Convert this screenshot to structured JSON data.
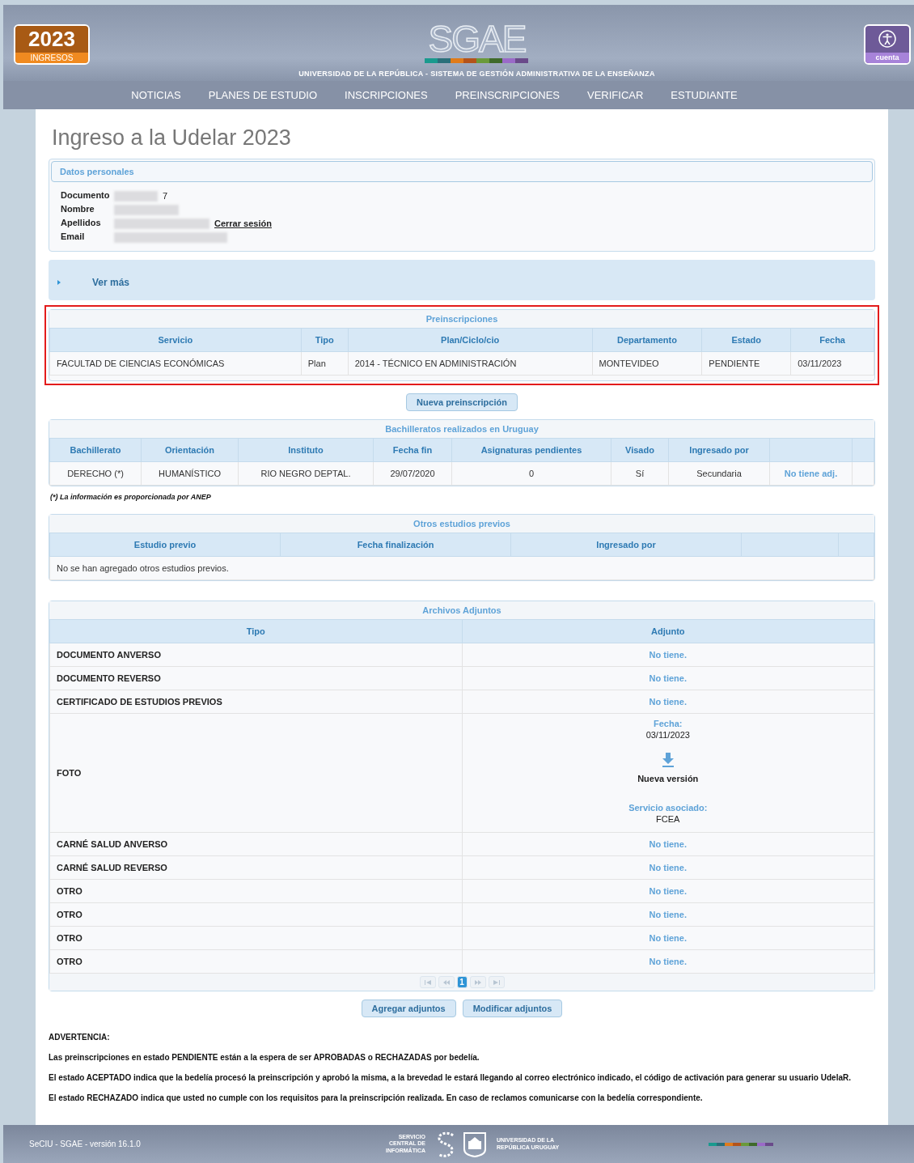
{
  "header": {
    "badge": {
      "year": "2023",
      "label": "INGRESOS"
    },
    "logo": {
      "text": "SGAE",
      "tagline": "UNIVERSIDAD DE LA REPÚBLICA - SISTEMA DE GESTIÓN ADMINISTRATIVA DE LA ENSEÑANZA"
    },
    "account": {
      "label": "cuenta"
    },
    "nav": [
      {
        "label": "NOTICIAS"
      },
      {
        "label": "PLANES DE ESTUDIO"
      },
      {
        "label": "INSCRIPCIONES"
      },
      {
        "label": "PREINSCRIPCIONES"
      },
      {
        "label": "VERIFICAR"
      },
      {
        "label": "ESTUDIANTE"
      }
    ]
  },
  "page_title": "Ingreso a la Udelar 2023",
  "personal": {
    "title": "Datos personales",
    "fields": [
      {
        "label": "Documento",
        "value": "7",
        "redacted": true
      },
      {
        "label": "Nombre",
        "redacted": true
      },
      {
        "label": "Apellidos",
        "redacted": true
      },
      {
        "label": "Email",
        "redacted": true
      }
    ],
    "logout": "Cerrar sesión"
  },
  "ver_mas": {
    "label": "Ver más",
    "expanded": false
  },
  "preinscripciones": {
    "title": "Preinscripciones",
    "highlighted": true,
    "columns": [
      "Servicio",
      "Tipo",
      "Plan/Ciclo/cio",
      "Departamento",
      "Estado",
      "Fecha"
    ],
    "rows": [
      [
        "FACULTAD DE CIENCIAS ECONÓMICAS",
        "Plan",
        "2014 - TÉCNICO EN ADMINISTRACIÓN",
        "MONTEVIDEO",
        "PENDIENTE",
        "03/11/2023"
      ]
    ]
  },
  "new_button": "Nueva preinscripción",
  "bachilleratos": {
    "title": "Bachilleratos realizados en Uruguay",
    "columns": [
      "Bachillerato",
      "Orientación",
      "Instituto",
      "Fecha fin",
      "Asignaturas pendientes",
      "Visado",
      "Ingresado por"
    ],
    "rows": [
      {
        "cells": [
          "DERECHO (*)",
          "HUMANÍSTICO",
          "RIO NEGRO DEPTAL.",
          "29/07/2020",
          "0",
          "Sí",
          "Secundaria"
        ],
        "link": "No tiene adj."
      }
    ]
  },
  "note": "(*) La información es proporcionada por ANEP",
  "otros": {
    "title": "Otros estudios previos",
    "columns": [
      "Estudio previo",
      "Fecha finalización",
      "Ingresado por"
    ],
    "empty_message": "No se han agregado otros estudios previos."
  },
  "archivos": {
    "title": "Archivos Adjuntos",
    "columns": [
      "Tipo",
      "Adjunto"
    ],
    "rows": [
      {
        "tipo": "DOCUMENTO ANVERSO",
        "kind": "none",
        "adjunto": "No tiene."
      },
      {
        "tipo": "DOCUMENTO REVERSO",
        "kind": "none",
        "adjunto": "No tiene."
      },
      {
        "tipo": "CERTIFICADO DE ESTUDIOS PREVIOS",
        "kind": "none",
        "adjunto": "No tiene."
      },
      {
        "tipo": "FOTO",
        "kind": "file",
        "fecha_label": "Fecha:",
        "fecha": "03/11/2023",
        "action": "Nueva versión",
        "servicio_label": "Servicio asociado:",
        "servicio": "FCEA"
      },
      {
        "tipo": "CARNÉ SALUD ANVERSO",
        "kind": "none",
        "adjunto": "No tiene."
      },
      {
        "tipo": "CARNÉ SALUD REVERSO",
        "kind": "none",
        "adjunto": "No tiene."
      },
      {
        "tipo": "OTRO",
        "kind": "none",
        "adjunto": "No tiene."
      },
      {
        "tipo": "OTRO",
        "kind": "none",
        "adjunto": "No tiene."
      },
      {
        "tipo": "OTRO",
        "kind": "none",
        "adjunto": "No tiene."
      },
      {
        "tipo": "OTRO",
        "kind": "none",
        "adjunto": "No tiene."
      }
    ],
    "pages": [
      {
        "label": "1",
        "selected": true
      }
    ]
  },
  "buttons": [
    "Agregar adjuntos",
    "Modificar adjuntos"
  ],
  "warning": {
    "title": "ADVERTENCIA:",
    "paragraphs": [
      "Las preinscripciones en estado PENDIENTE están a la espera de ser APROBADAS o RECHAZADAS por bedelía.",
      "El estado ACEPTADO indica que la bedelía procesó la preinscripción y aprobó la misma, a la brevedad le estará llegando al correo electrónico indicado, el código de activación para generar su usuario UdelaR.",
      "El estado RECHAZADO indica que usted no cumple con los requisitos para la preinscripción realizada. En caso de reclamos comunicarse con la bedelía correspondiente."
    ]
  },
  "footer": {
    "version": "SeCIU - SGAE - versión 16.1.0",
    "org1": "SERVICIO CENTRAL DE INFORMÁTICA",
    "org2": "UNIVERSIDAD DE LA REPÚBLICA URUGUAY"
  }
}
